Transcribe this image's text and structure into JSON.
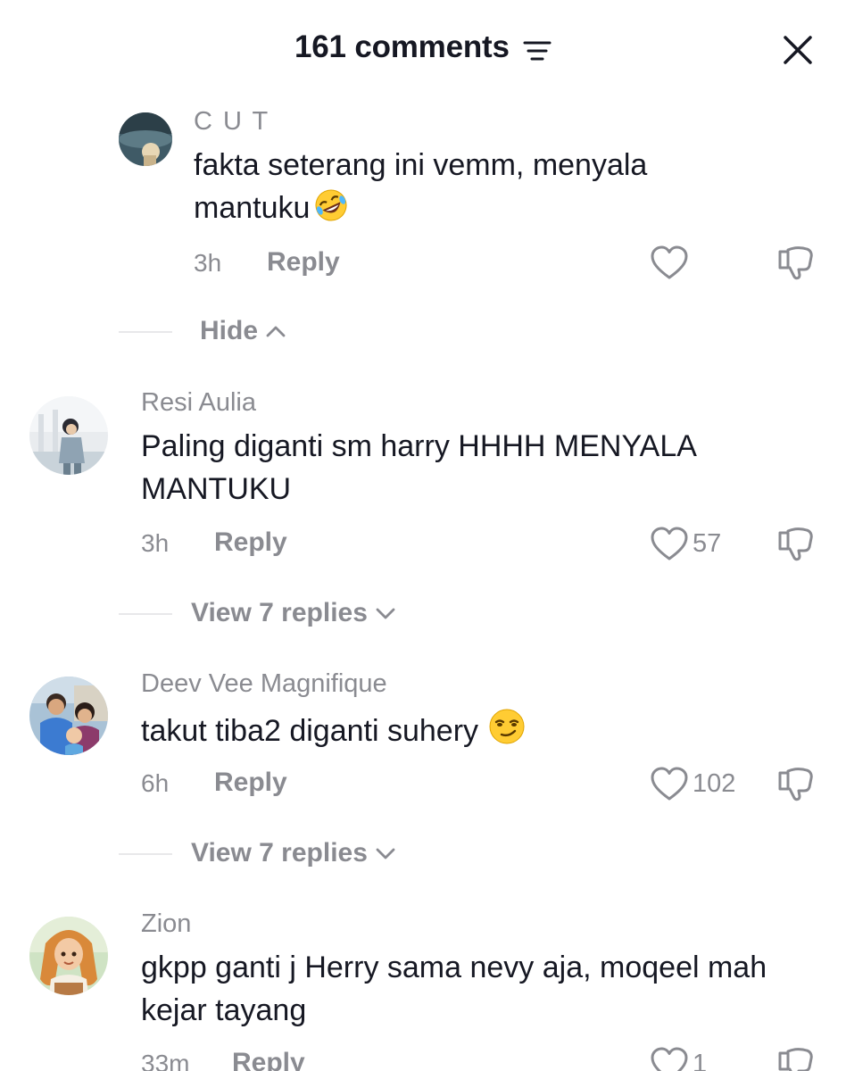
{
  "header": {
    "title": "161 comments",
    "sort_icon": "sort-lines-icon",
    "close_icon": "close-icon"
  },
  "comments": [
    {
      "username": "C U T",
      "text": "fakta seterang ini vemm, menyala mantuku",
      "emoji": "rolling-on-floor-laughing",
      "time": "3h",
      "reply_label": "Reply",
      "likes": "",
      "thread_toggle": "Hide"
    },
    {
      "username": "Resi Aulia",
      "text": "Paling diganti sm harry HHHH MENYALA MANTUKU",
      "time": "3h",
      "reply_label": "Reply",
      "likes": "57",
      "thread_toggle": "View 7 replies"
    },
    {
      "username": "Deev Vee Magnifique",
      "text": "takut tiba2 diganti suhery",
      "emoji": "smirking-face",
      "time": "6h",
      "reply_label": "Reply",
      "likes": "102",
      "thread_toggle": "View 7 replies"
    },
    {
      "username": "Zion",
      "text": "gkpp ganti j Herry sama nevy aja, moqeel mah kejar tayang",
      "time": "33m",
      "reply_label": "Reply",
      "likes": "1"
    }
  ],
  "colors": {
    "primary_text": "#161823",
    "secondary_text": "#8a8b91",
    "divider": "#e8e8ea",
    "background": "#ffffff"
  }
}
